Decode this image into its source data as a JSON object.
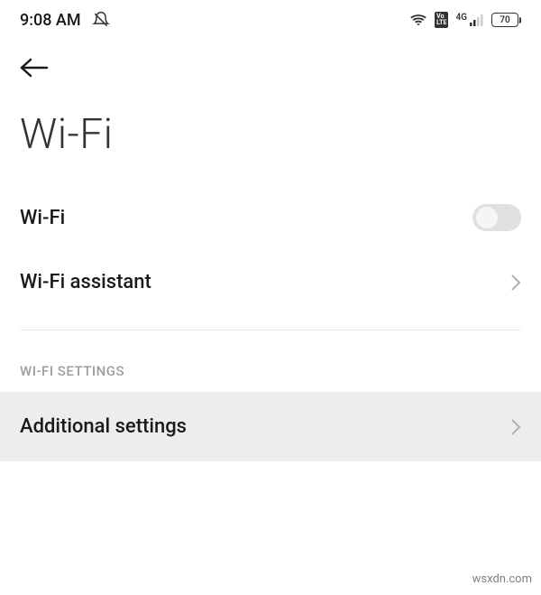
{
  "status_bar": {
    "time": "9:08 AM",
    "battery_level": "70",
    "network_type": "4G"
  },
  "page": {
    "title": "Wi-Fi"
  },
  "settings": {
    "wifi_toggle_label": "Wi-Fi",
    "wifi_toggle_on": false,
    "wifi_assistant_label": "Wi-Fi assistant"
  },
  "section": {
    "header": "WI-FI SETTINGS",
    "additional_settings_label": "Additional settings"
  },
  "watermark": "wsxdn.com"
}
